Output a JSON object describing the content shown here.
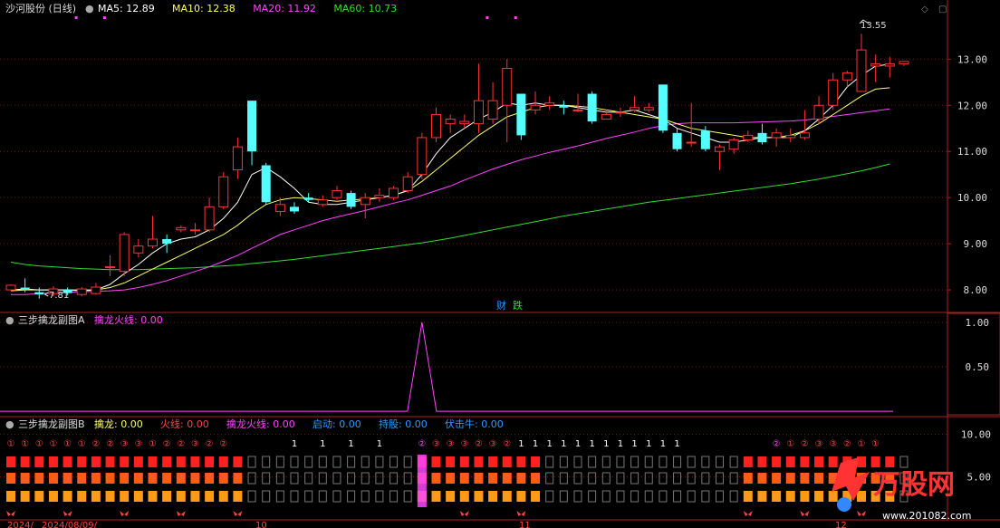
{
  "main_panel": {
    "title": "沙河股份 (日线)",
    "ma_items": [
      {
        "label": "MA5:",
        "value": "12.89",
        "color": "#ffffff"
      },
      {
        "label": "MA10:",
        "value": "12.38",
        "color": "#ffff66"
      },
      {
        "label": "MA20:",
        "value": "11.92",
        "color": "#ff44ff"
      },
      {
        "label": "MA60:",
        "value": "10.73",
        "color": "#33dd33"
      }
    ],
    "high_label": "13.55",
    "low_label": "7.81",
    "marker_cai": "财",
    "marker_die": "跌"
  },
  "panel_a": {
    "title": "三步擒龙副图A",
    "items": [
      {
        "label": "擒龙火线:",
        "value": "0.00",
        "color": "#ff44ff"
      }
    ]
  },
  "panel_b": {
    "title": "三步擒龙副图B",
    "items": [
      {
        "label": "擒龙:",
        "value": "0.00",
        "color": "#ffff66"
      },
      {
        "label": "火线:",
        "value": "0.00",
        "color": "#ff4444"
      },
      {
        "label": "擒龙火线:",
        "value": "0.00",
        "color": "#ff44ff"
      },
      {
        "label": "启动:",
        "value": "0.00",
        "color": "#3399ff"
      },
      {
        "label": "持股:",
        "value": "0.00",
        "color": "#3399ff"
      },
      {
        "label": "伏击牛:",
        "value": "0.00",
        "color": "#3399ff"
      }
    ],
    "circled_labels": [
      "①",
      "①",
      "①",
      "①",
      "①",
      "①",
      "②",
      "②",
      "③",
      "③",
      "①",
      "②",
      "②",
      "③",
      "②",
      "②",
      "1",
      "1",
      "1",
      "1",
      "②",
      "③",
      "③",
      "③",
      "②",
      "③",
      "②",
      "1",
      "1",
      "1",
      "1",
      "1",
      "1",
      "1",
      "1",
      "1",
      "1",
      "1",
      "1",
      "②",
      "①",
      "②",
      "③",
      "③",
      "②",
      "①",
      "①"
    ],
    "right_labels": [
      "10.00",
      "5.00"
    ]
  },
  "date_axis": {
    "labels": [
      "2024/",
      "2024/08/09/",
      "10",
      "11",
      "12"
    ]
  },
  "watermark": {
    "brand": "万股网",
    "url": "www.201082.com"
  },
  "chart_data": {
    "type": "candlestick",
    "price_axis": {
      "ticks": [
        8.0,
        9.0,
        10.0,
        11.0,
        12.0,
        13.0
      ],
      "range": [
        7.55,
        13.85
      ]
    },
    "candles": [
      [
        8.0,
        8.1,
        8.12,
        7.98
      ],
      [
        8.05,
        8.0,
        8.25,
        7.95
      ],
      [
        7.95,
        7.9,
        8.05,
        7.81
      ],
      [
        7.92,
        8.02,
        8.08,
        7.86
      ],
      [
        8.0,
        7.93,
        8.05,
        7.88
      ],
      [
        7.9,
        8.02,
        8.06,
        7.86
      ],
      [
        7.92,
        8.06,
        8.15,
        7.9
      ],
      [
        8.5,
        8.5,
        8.75,
        8.3
      ],
      [
        8.4,
        9.2,
        9.25,
        8.3
      ],
      [
        8.8,
        8.95,
        9.1,
        8.7
      ],
      [
        8.95,
        9.1,
        9.6,
        8.9
      ],
      [
        9.1,
        9.0,
        9.2,
        8.8
      ],
      [
        9.3,
        9.35,
        9.4,
        9.25
      ],
      [
        9.3,
        9.3,
        9.45,
        9.2
      ],
      [
        9.3,
        9.8,
        10.0,
        9.25
      ],
      [
        9.8,
        10.45,
        10.55,
        9.75
      ],
      [
        10.6,
        11.1,
        11.3,
        10.4
      ],
      [
        12.1,
        11.0,
        12.1,
        10.7
      ],
      [
        10.7,
        9.9,
        10.75,
        9.85
      ],
      [
        9.7,
        9.85,
        10.0,
        9.6
      ],
      [
        9.8,
        9.7,
        9.9,
        9.65
      ],
      [
        10.0,
        9.95,
        10.1,
        9.9
      ],
      [
        9.85,
        9.95,
        10.05,
        9.8
      ],
      [
        10.0,
        10.15,
        10.25,
        9.95
      ],
      [
        10.1,
        9.8,
        10.15,
        9.75
      ],
      [
        9.85,
        10.0,
        10.1,
        9.55
      ],
      [
        10.0,
        10.05,
        10.2,
        9.9
      ],
      [
        10.0,
        10.2,
        10.25,
        9.95
      ],
      [
        10.15,
        10.45,
        10.55,
        10.1
      ],
      [
        10.5,
        11.3,
        11.4,
        10.4
      ],
      [
        11.3,
        11.8,
        11.95,
        11.2
      ],
      [
        11.6,
        11.7,
        11.8,
        11.4
      ],
      [
        11.6,
        11.65,
        11.8,
        11.5
      ],
      [
        11.6,
        12.1,
        12.9,
        11.4
      ],
      [
        11.7,
        12.1,
        12.5,
        11.6
      ],
      [
        12.0,
        12.8,
        13.0,
        11.2
      ],
      [
        12.25,
        11.35,
        12.25,
        11.25
      ],
      [
        11.9,
        12.0,
        12.3,
        11.8
      ],
      [
        12.0,
        12.05,
        12.2,
        11.9
      ],
      [
        12.0,
        11.95,
        12.1,
        11.8
      ],
      [
        11.9,
        11.9,
        12.25,
        11.85
      ],
      [
        12.25,
        11.65,
        12.3,
        11.6
      ],
      [
        11.7,
        11.8,
        11.9,
        11.7
      ],
      [
        11.85,
        11.85,
        11.95,
        11.75
      ],
      [
        11.9,
        11.95,
        12.2,
        11.85
      ],
      [
        11.9,
        11.95,
        12.05,
        11.85
      ],
      [
        12.45,
        11.45,
        12.45,
        11.4
      ],
      [
        11.4,
        11.05,
        11.5,
        11.0
      ],
      [
        11.2,
        11.2,
        12.05,
        11.1
      ],
      [
        11.45,
        11.05,
        11.55,
        11.0
      ],
      [
        11.0,
        11.1,
        11.15,
        10.6
      ],
      [
        11.05,
        11.25,
        11.3,
        10.95
      ],
      [
        11.25,
        11.35,
        11.45,
        11.2
      ],
      [
        11.4,
        11.2,
        11.6,
        11.15
      ],
      [
        11.3,
        11.4,
        11.5,
        11.1
      ],
      [
        11.3,
        11.35,
        11.5,
        11.2
      ],
      [
        11.3,
        11.4,
        11.9,
        11.25
      ],
      [
        11.7,
        12.0,
        12.2,
        11.6
      ],
      [
        12.0,
        12.55,
        12.7,
        11.9
      ],
      [
        12.55,
        12.7,
        12.75,
        12.4
      ],
      [
        12.3,
        13.2,
        13.55,
        12.3
      ],
      [
        12.85,
        12.9,
        13.1,
        12.5
      ],
      [
        12.85,
        12.9,
        13.05,
        12.6
      ],
      [
        12.9,
        12.95,
        12.95,
        12.85
      ]
    ],
    "ma5": [
      8.0,
      8.02,
      8.0,
      8.0,
      8.0,
      7.98,
      8.0,
      8.12,
      8.35,
      8.55,
      8.8,
      9.0,
      9.1,
      9.15,
      9.3,
      9.55,
      9.9,
      10.5,
      10.65,
      10.45,
      10.2,
      9.9,
      9.85,
      9.85,
      9.9,
      9.95,
      10.0,
      10.05,
      10.15,
      10.5,
      10.95,
      11.3,
      11.5,
      11.7,
      11.85,
      12.05,
      12.0,
      12.05,
      12.0,
      12.0,
      11.95,
      11.9,
      11.85,
      11.85,
      11.9,
      11.8,
      11.7,
      11.5,
      11.4,
      11.3,
      11.2,
      11.2,
      11.25,
      11.3,
      11.3,
      11.3,
      11.45,
      11.7,
      12.0,
      12.4,
      12.65,
      12.85,
      12.89
    ],
    "ma10": [
      7.98,
      8.0,
      8.0,
      8.0,
      8.0,
      8.0,
      8.0,
      8.05,
      8.15,
      8.3,
      8.45,
      8.6,
      8.75,
      8.9,
      9.05,
      9.2,
      9.4,
      9.65,
      9.85,
      9.95,
      10.0,
      9.98,
      9.95,
      9.92,
      9.95,
      9.97,
      10.0,
      10.05,
      10.15,
      10.35,
      10.6,
      10.85,
      11.1,
      11.35,
      11.55,
      11.75,
      11.85,
      11.95,
      12.0,
      12.0,
      11.98,
      11.95,
      11.9,
      11.85,
      11.8,
      11.75,
      11.7,
      11.6,
      11.5,
      11.45,
      11.4,
      11.35,
      11.3,
      11.3,
      11.3,
      11.35,
      11.45,
      11.6,
      11.8,
      12.0,
      12.2,
      12.35,
      12.38
    ],
    "ma20": [
      7.9,
      7.9,
      7.92,
      7.93,
      7.95,
      7.96,
      7.97,
      7.98,
      8.0,
      8.05,
      8.12,
      8.2,
      8.3,
      8.4,
      8.5,
      8.62,
      8.75,
      8.9,
      9.05,
      9.2,
      9.3,
      9.4,
      9.5,
      9.58,
      9.65,
      9.72,
      9.8,
      9.88,
      9.95,
      10.05,
      10.15,
      10.25,
      10.38,
      10.5,
      10.62,
      10.72,
      10.82,
      10.9,
      10.98,
      11.05,
      11.12,
      11.2,
      11.28,
      11.35,
      11.42,
      11.5,
      11.56,
      11.6,
      11.62,
      11.62,
      11.62,
      11.62,
      11.63,
      11.64,
      11.65,
      11.66,
      11.68,
      11.72,
      11.76,
      11.8,
      11.84,
      11.88,
      11.92
    ],
    "ma60": [
      8.6,
      8.55,
      8.52,
      8.5,
      8.48,
      8.46,
      8.45,
      8.44,
      8.44,
      8.44,
      8.45,
      8.46,
      8.47,
      8.48,
      8.5,
      8.52,
      8.54,
      8.57,
      8.6,
      8.63,
      8.66,
      8.7,
      8.74,
      8.78,
      8.82,
      8.86,
      8.9,
      8.94,
      8.98,
      9.02,
      9.07,
      9.12,
      9.18,
      9.24,
      9.3,
      9.36,
      9.42,
      9.48,
      9.54,
      9.6,
      9.65,
      9.7,
      9.75,
      9.8,
      9.85,
      9.9,
      9.94,
      9.98,
      10.02,
      10.06,
      10.1,
      10.14,
      10.18,
      10.22,
      10.26,
      10.3,
      10.35,
      10.4,
      10.46,
      10.52,
      10.58,
      10.65,
      10.73
    ],
    "panel_a": {
      "axis_ticks": [
        0.5,
        1.0
      ],
      "range": [
        -0.05,
        1.1
      ],
      "spike_index": 29,
      "spike_value": 1.0
    },
    "panel_b": {
      "axis_ticks": [
        5.0,
        10.0
      ],
      "row_colors": [
        "#ff2020",
        "#ff5a1a",
        "#ff9a18"
      ],
      "active_ranges": [
        [
          0,
          16
        ],
        [
          29,
          37
        ],
        [
          52,
          62
        ]
      ],
      "highlight_index": 29
    }
  }
}
